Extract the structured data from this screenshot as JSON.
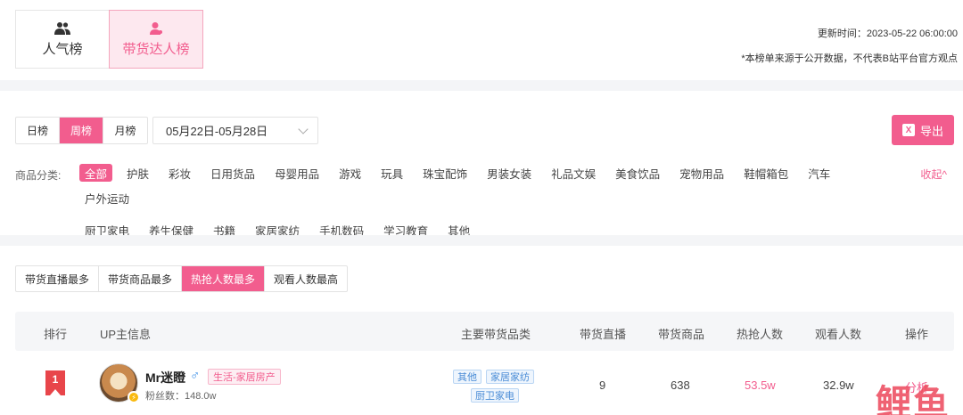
{
  "top_tabs": [
    {
      "label": "人气榜",
      "icon": "users-icon"
    },
    {
      "label": "带货达人榜",
      "icon": "user-icon"
    }
  ],
  "update_time": "更新时间：2023-05-22 06:00:00",
  "disclaimer": "*本榜单来源于公开数据，不代表B站平台官方观点",
  "period_tabs": [
    "日榜",
    "周榜",
    "月榜"
  ],
  "period_selected": "周榜",
  "date_range": "05月22日-05月28日",
  "export_label": "导出",
  "category_label": "商品分类:",
  "categories_row1": [
    "全部",
    "护肤",
    "彩妆",
    "日用货品",
    "母婴用品",
    "游戏",
    "玩具",
    "珠宝配饰",
    "男装女装",
    "礼品文娱",
    "美食饮品",
    "宠物用品",
    "鞋帽箱包",
    "汽车",
    "户外运动"
  ],
  "categories_row2": [
    "厨卫家电",
    "养生保健",
    "书籍",
    "家居家纺",
    "手机数码",
    "学习教育",
    "其他"
  ],
  "collapse_label": "收起^",
  "sort_tabs": [
    "带货直播最多",
    "带货商品最多",
    "热抢人数最多",
    "观看人数最高"
  ],
  "sort_selected": "热抢人数最多",
  "table": {
    "headers": [
      "排行",
      "UP主信息",
      "主要带货品类",
      "带货直播",
      "带货商品",
      "热抢人数",
      "观看人数",
      "操作"
    ],
    "rows": [
      {
        "rank": "1",
        "name": "Mr迷瞪",
        "gender": "♂",
        "tag": "生活-家居房产",
        "fans": "粉丝数：148.0w",
        "categories": [
          "其他",
          "家居家纺",
          "厨卫家电"
        ],
        "lives": "9",
        "goods": "638",
        "hot": "53.5w",
        "views": "32.9w",
        "action": "分析"
      }
    ]
  },
  "watermark": "鲤鱼",
  "colors": {
    "accent": "#f25d8e",
    "rank_red": "#e8454a",
    "link_blue": "#4a8cd6"
  }
}
